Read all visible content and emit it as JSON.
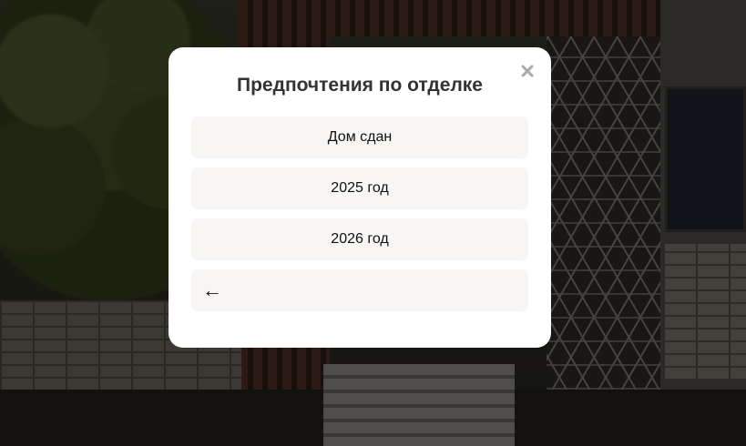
{
  "modal": {
    "title": "Предпочтения по отделке",
    "close_icon": "close-icon",
    "options": [
      {
        "label": "Дом сдан"
      },
      {
        "label": "2025 год"
      },
      {
        "label": "2026 год"
      }
    ],
    "back": {
      "icon": "arrow-left-icon",
      "glyph": "←"
    }
  },
  "colors": {
    "overlay": "#1d1a16",
    "modal_bg": "#ffffff",
    "option_bg": "#f7f6f4",
    "title_text": "#333333",
    "close_icon": "#a9a9a9"
  }
}
